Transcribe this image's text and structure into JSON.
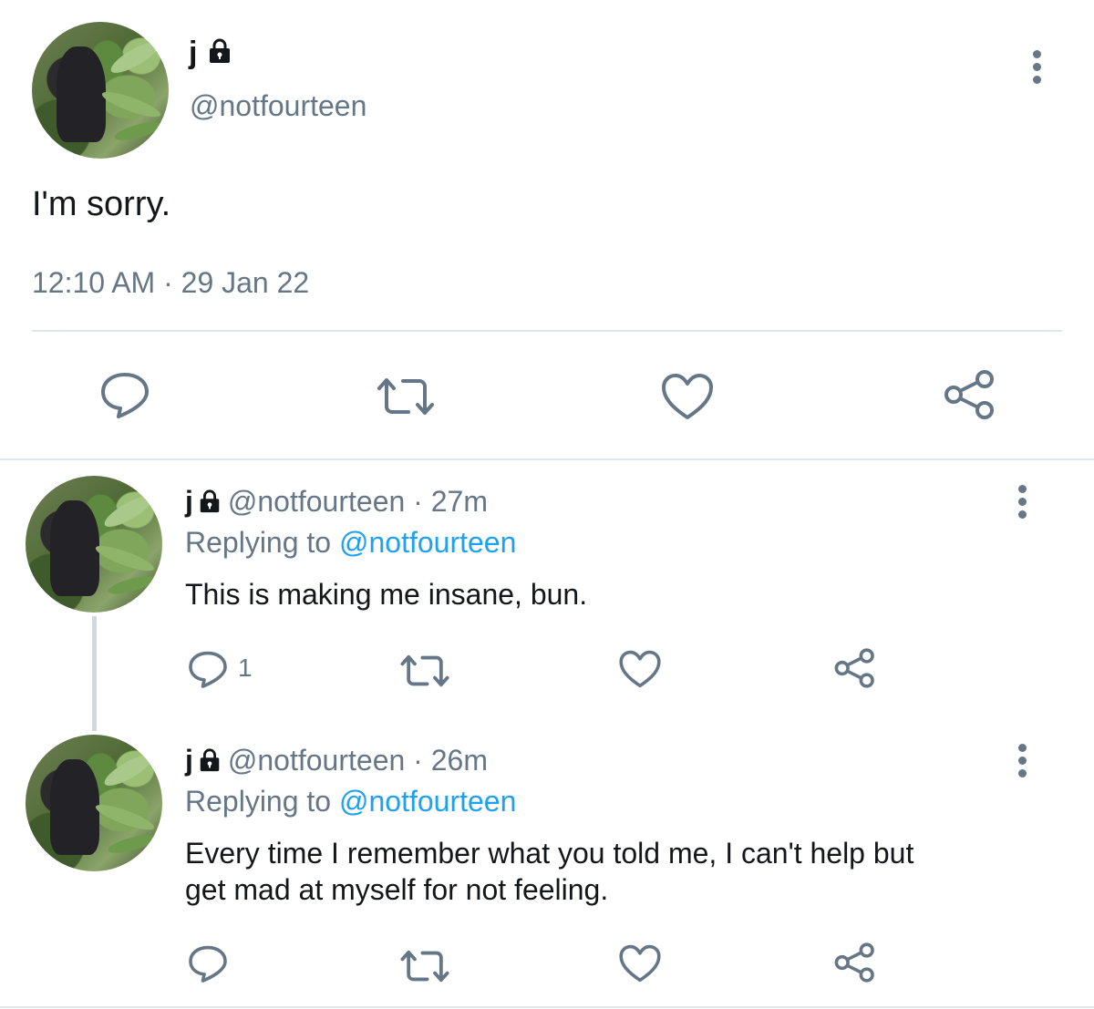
{
  "main_tweet": {
    "display_name": "j",
    "handle": "@notfourteen",
    "text": "I'm sorry.",
    "timestamp": "12:10 AM · 29 Jan 22"
  },
  "replies": [
    {
      "display_name": "j",
      "handle": "@notfourteen",
      "separator": " · ",
      "time": "27m",
      "replying_prefix": "Replying to ",
      "replying_to": "@notfourteen",
      "text": "This is making me insane, bun.",
      "reply_count": "1"
    },
    {
      "display_name": "j",
      "handle": "@notfourteen",
      "separator": " · ",
      "time": "26m",
      "replying_prefix": "Replying to ",
      "replying_to": "@notfourteen",
      "text_line1": "Every time I remember what you told me, I can't help but",
      "text_line2": "get mad at myself for not feeling.",
      "reply_count": ""
    }
  ],
  "icons": {
    "reply": "speech-bubble",
    "retweet": "retweet-arrows",
    "like": "heart",
    "share": "share-nodes",
    "more": "vertical-dots",
    "lock": "padlock"
  },
  "colors": {
    "text": "#14171a",
    "secondary": "#657786",
    "link": "#1da1f2",
    "divider": "#e1e8ed"
  }
}
